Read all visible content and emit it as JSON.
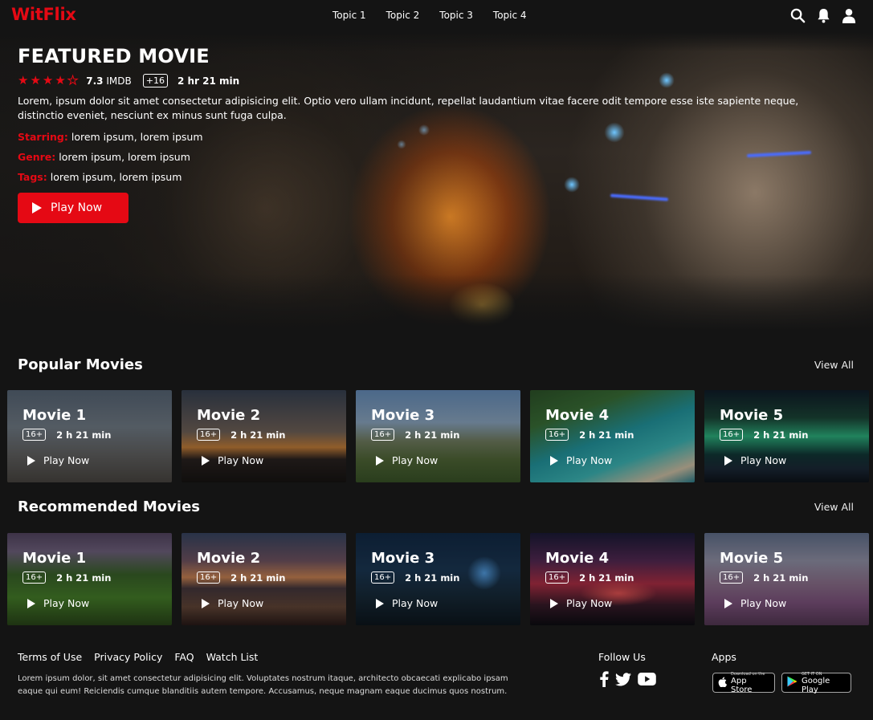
{
  "header": {
    "logo": "WitFlix",
    "nav": [
      "Topic 1",
      "Topic 2",
      "Topic 3",
      "Topic 4"
    ],
    "icons": [
      "search-icon",
      "bell-icon",
      "user-icon"
    ]
  },
  "hero": {
    "title": "FEATURED MOVIE",
    "rating_stars": 4,
    "rating_value": "7.3",
    "rating_source": "IMDB",
    "age": "+16",
    "duration": "2 hr 21 min",
    "description": "Lorem, ipsum dolor sit amet consectetur adipisicing elit. Optio vero ullam incidunt, repellat laudantium vitae facere odit tempore esse iste sapiente neque, distinctio eveniet, nesciunt ex minus sunt fuga culpa.",
    "starring_label": "Starring:",
    "starring": "lorem ipsum, lorem ipsum",
    "genre_label": "Genre:",
    "genre": "lorem ipsum, lorem ipsum",
    "tags_label": "Tags:",
    "tags": "lorem ipsum, lorem ipsum",
    "play_label": "Play Now"
  },
  "popular": {
    "title": "Popular Movies",
    "view_all": "View All",
    "movies": [
      {
        "title": "Movie 1",
        "age": "16+",
        "duration": "2 h 21 min",
        "play": "Play Now"
      },
      {
        "title": "Movie 2",
        "age": "16+",
        "duration": "2 h 21 min",
        "play": "Play Now"
      },
      {
        "title": "Movie 3",
        "age": "16+",
        "duration": "2 h 21 min",
        "play": "Play Now"
      },
      {
        "title": "Movie 4",
        "age": "16+",
        "duration": "2 h 21 min",
        "play": "Play Now"
      },
      {
        "title": "Movie 5",
        "age": "16+",
        "duration": "2 h 21 min",
        "play": "Play Now"
      }
    ]
  },
  "recommended": {
    "title": "Recommended Movies",
    "view_all": "View All",
    "movies": [
      {
        "title": "Movie 1",
        "age": "16+",
        "duration": "2 h 21 min",
        "play": "Play Now"
      },
      {
        "title": "Movie 2",
        "age": "16+",
        "duration": "2 h 21 min",
        "play": "Play Now"
      },
      {
        "title": "Movie 3",
        "age": "16+",
        "duration": "2 h 21 min",
        "play": "Play Now"
      },
      {
        "title": "Movie 4",
        "age": "16+",
        "duration": "2 h 21 min",
        "play": "Play Now"
      },
      {
        "title": "Movie 5",
        "age": "16+",
        "duration": "2 h 21 min",
        "play": "Play Now"
      }
    ]
  },
  "footer": {
    "links": [
      "Terms of Use",
      "Privacy Policy",
      "FAQ",
      "Watch List"
    ],
    "text": "Lorem ipsum dolor, sit amet consectetur adipisicing elit. Voluptates nostrum itaque, architecto obcaecati explicabo ipsam eaque qui eum! Reiciendis cumque blanditiis autem tempore. Accusamus, neque magnam eaque ducimus quos nostrum.",
    "follow_title": "Follow Us",
    "apps_title": "Apps",
    "app_store_small": "Download on the",
    "app_store_big": "App Store",
    "google_play_small": "GET IT ON",
    "google_play_big": "Google Play"
  },
  "colors": {
    "accent": "#e50914",
    "background": "#141414"
  }
}
